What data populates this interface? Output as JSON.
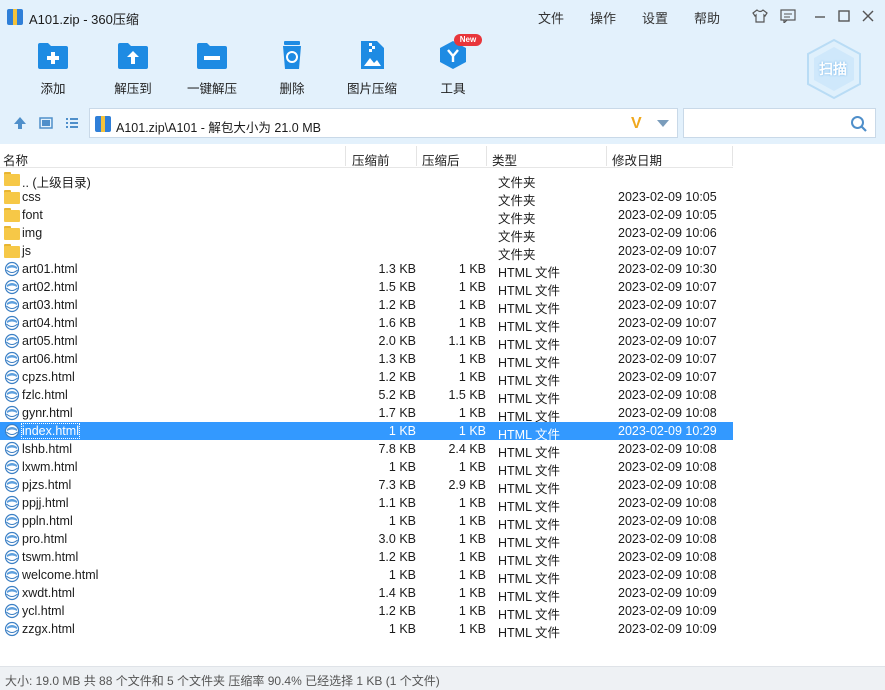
{
  "window": {
    "title": "A101.zip - 360压缩",
    "menus": [
      "文件",
      "操作",
      "设置",
      "帮助"
    ]
  },
  "toolbar": {
    "buttons": [
      "添加",
      "解压到",
      "一键解压",
      "删除",
      "图片压缩",
      "工具"
    ],
    "new_badge": "New",
    "scan_label": "扫描"
  },
  "address": {
    "path": "A101.zip\\A101 - 解包大小为 21.0 MB",
    "v_logo": "V",
    "search_placeholder": ""
  },
  "columns": {
    "name": "名称",
    "size": "压缩前",
    "compressed": "压缩后",
    "type": "类型",
    "date": "修改日期"
  },
  "files": [
    {
      "name": ".. (上级目录)",
      "size": "",
      "compressed": "",
      "type": "文件夹",
      "date": "",
      "kind": "folder"
    },
    {
      "name": "css",
      "size": "",
      "compressed": "",
      "type": "文件夹",
      "date": "2023-02-09 10:05",
      "kind": "folder"
    },
    {
      "name": "font",
      "size": "",
      "compressed": "",
      "type": "文件夹",
      "date": "2023-02-09 10:05",
      "kind": "folder"
    },
    {
      "name": "img",
      "size": "",
      "compressed": "",
      "type": "文件夹",
      "date": "2023-02-09 10:06",
      "kind": "folder"
    },
    {
      "name": "js",
      "size": "",
      "compressed": "",
      "type": "文件夹",
      "date": "2023-02-09 10:07",
      "kind": "folder"
    },
    {
      "name": "art01.html",
      "size": "1.3 KB",
      "compressed": "1 KB",
      "type": "HTML 文件",
      "date": "2023-02-09 10:30",
      "kind": "html"
    },
    {
      "name": "art02.html",
      "size": "1.5 KB",
      "compressed": "1 KB",
      "type": "HTML 文件",
      "date": "2023-02-09 10:07",
      "kind": "html"
    },
    {
      "name": "art03.html",
      "size": "1.2 KB",
      "compressed": "1 KB",
      "type": "HTML 文件",
      "date": "2023-02-09 10:07",
      "kind": "html"
    },
    {
      "name": "art04.html",
      "size": "1.6 KB",
      "compressed": "1 KB",
      "type": "HTML 文件",
      "date": "2023-02-09 10:07",
      "kind": "html"
    },
    {
      "name": "art05.html",
      "size": "2.0 KB",
      "compressed": "1.1 KB",
      "type": "HTML 文件",
      "date": "2023-02-09 10:07",
      "kind": "html"
    },
    {
      "name": "art06.html",
      "size": "1.3 KB",
      "compressed": "1 KB",
      "type": "HTML 文件",
      "date": "2023-02-09 10:07",
      "kind": "html"
    },
    {
      "name": "cpzs.html",
      "size": "1.2 KB",
      "compressed": "1 KB",
      "type": "HTML 文件",
      "date": "2023-02-09 10:07",
      "kind": "html"
    },
    {
      "name": "fzlc.html",
      "size": "5.2 KB",
      "compressed": "1.5 KB",
      "type": "HTML 文件",
      "date": "2023-02-09 10:08",
      "kind": "html"
    },
    {
      "name": "gynr.html",
      "size": "1.7 KB",
      "compressed": "1 KB",
      "type": "HTML 文件",
      "date": "2023-02-09 10:08",
      "kind": "html"
    },
    {
      "name": "index.html",
      "size": "1 KB",
      "compressed": "1 KB",
      "type": "HTML 文件",
      "date": "2023-02-09 10:29",
      "kind": "html",
      "selected": true
    },
    {
      "name": "lshb.html",
      "size": "7.8 KB",
      "compressed": "2.4 KB",
      "type": "HTML 文件",
      "date": "2023-02-09 10:08",
      "kind": "html"
    },
    {
      "name": "lxwm.html",
      "size": "1 KB",
      "compressed": "1 KB",
      "type": "HTML 文件",
      "date": "2023-02-09 10:08",
      "kind": "html"
    },
    {
      "name": "pjzs.html",
      "size": "7.3 KB",
      "compressed": "2.9 KB",
      "type": "HTML 文件",
      "date": "2023-02-09 10:08",
      "kind": "html"
    },
    {
      "name": "ppjj.html",
      "size": "1.1 KB",
      "compressed": "1 KB",
      "type": "HTML 文件",
      "date": "2023-02-09 10:08",
      "kind": "html"
    },
    {
      "name": "ppln.html",
      "size": "1 KB",
      "compressed": "1 KB",
      "type": "HTML 文件",
      "date": "2023-02-09 10:08",
      "kind": "html"
    },
    {
      "name": "pro.html",
      "size": "3.0 KB",
      "compressed": "1 KB",
      "type": "HTML 文件",
      "date": "2023-02-09 10:08",
      "kind": "html"
    },
    {
      "name": "tswm.html",
      "size": "1.2 KB",
      "compressed": "1 KB",
      "type": "HTML 文件",
      "date": "2023-02-09 10:08",
      "kind": "html"
    },
    {
      "name": "welcome.html",
      "size": "1 KB",
      "compressed": "1 KB",
      "type": "HTML 文件",
      "date": "2023-02-09 10:08",
      "kind": "html"
    },
    {
      "name": "xwdt.html",
      "size": "1.4 KB",
      "compressed": "1 KB",
      "type": "HTML 文件",
      "date": "2023-02-09 10:09",
      "kind": "html"
    },
    {
      "name": "ycl.html",
      "size": "1.2 KB",
      "compressed": "1 KB",
      "type": "HTML 文件",
      "date": "2023-02-09 10:09",
      "kind": "html"
    },
    {
      "name": "zzgx.html",
      "size": "1 KB",
      "compressed": "1 KB",
      "type": "HTML 文件",
      "date": "2023-02-09 10:09",
      "kind": "html"
    }
  ],
  "status": {
    "text": "大小: 19.0 MB 共 88 个文件和 5 个文件夹 压缩率 90.4% 已经选择 1 KB (1 个文件)"
  },
  "colors": {
    "chrome": "#e3f1fc",
    "accent": "#1e8be3",
    "selection": "#3399ff"
  }
}
